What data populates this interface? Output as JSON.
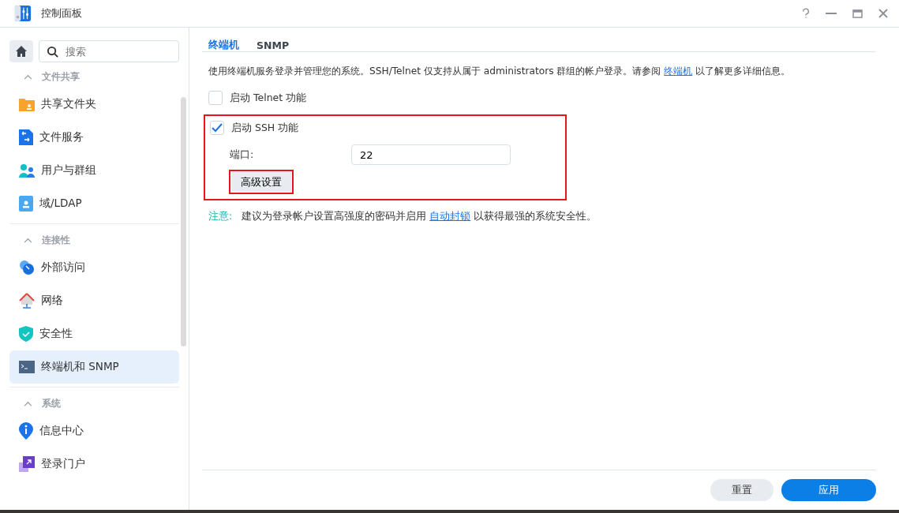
{
  "window": {
    "title": "控制面板"
  },
  "sidebar": {
    "search": {
      "placeholder": "搜索"
    },
    "groups": [
      {
        "label": "文件共享",
        "expanded": true,
        "items": [
          {
            "label": "共享文件夹",
            "kind": "folder",
            "selected": false
          },
          {
            "label": "文件服务",
            "kind": "fileservice",
            "selected": false
          },
          {
            "label": "用户与群组",
            "kind": "users",
            "selected": false
          },
          {
            "label": "域/LDAP",
            "kind": "domain",
            "selected": false
          }
        ]
      },
      {
        "label": "连接性",
        "expanded": true,
        "items": [
          {
            "label": "外部访问",
            "kind": "external",
            "selected": false
          },
          {
            "label": "网络",
            "kind": "network",
            "selected": false
          },
          {
            "label": "安全性",
            "kind": "security",
            "selected": false
          },
          {
            "label": "终端机和 SNMP",
            "kind": "terminal",
            "selected": true
          }
        ]
      },
      {
        "label": "系统",
        "expanded": true,
        "items": [
          {
            "label": "信息中心",
            "kind": "info",
            "selected": false
          },
          {
            "label": "登录门户",
            "kind": "portal",
            "selected": false
          }
        ]
      }
    ]
  },
  "tabs": [
    {
      "label": "终端机",
      "selected": true
    },
    {
      "label": "SNMP",
      "selected": false
    }
  ],
  "description": {
    "text": "使用终端机服务登录并管理您的系统。SSH/Telnet 仅支持从属于 administrators 群组的帐户登录。请参阅",
    "link": "终端机",
    "after": "以了解更多详细信息。"
  },
  "telnet": {
    "label": "启动 Telnet 功能",
    "checked": false
  },
  "ssh": {
    "label": "启动 SSH 功能",
    "checked": true,
    "annotated": true,
    "port_label": "端口:",
    "port": "22",
    "advanced_button": {
      "label": "高级设置",
      "annotated": true
    }
  },
  "note": {
    "label": "注意:",
    "text": "建议为登录帐户设置高强度的密码并启用",
    "link": "自动封锁",
    "after": "以获得最强的系统安全性。"
  },
  "buttons": [
    {
      "label": "重置",
      "kind": "secondary"
    },
    {
      "label": "应用",
      "kind": "primary"
    }
  ]
}
